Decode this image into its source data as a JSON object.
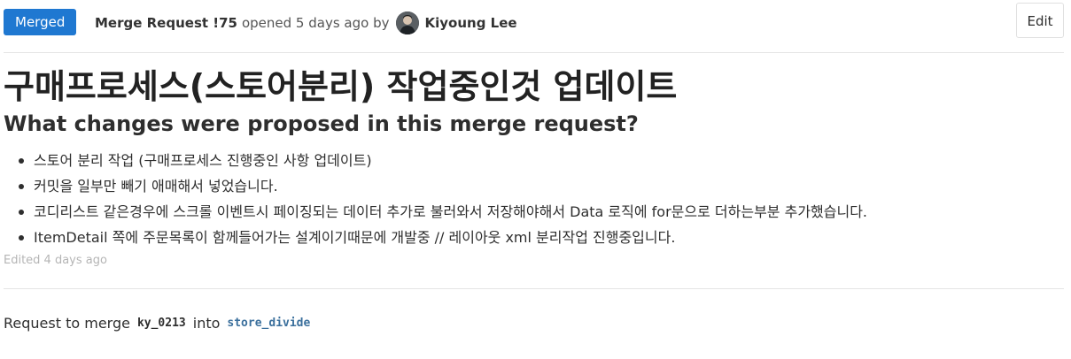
{
  "header": {
    "status_label": "Merged",
    "mr_ref": "Merge Request !75",
    "opened_text": "opened 5 days ago by",
    "author_name": "Kiyoung Lee",
    "edit_label": "Edit"
  },
  "title": "구매프로세스(스토어분리) 작업중인것 업데이트",
  "description": {
    "heading": "What changes were proposed in this merge request?",
    "items": [
      "스토어 분리 작업 (구매프로세스 진행중인 사항 업데이트)",
      "커밋을 일부만 빼기 애매해서 넣었습니다.",
      "코디리스트 같은경우에 스크롤 이벤트시 페이징되는 데이터 추가로 불러와서 저장해야해서 Data 로직에 for문으로 더하는부분 추가했습니다.",
      "ItemDetail 쪽에 주문목록이 함께들어가는 설계이기때문에 개발중 // 레이아웃 xml 분리작업 진행중입니다."
    ],
    "edited_note": "Edited 4 days ago"
  },
  "merge_info": {
    "prefix": "Request to merge",
    "source_branch": "ky_0213",
    "into": "into",
    "target_branch": "store_divide"
  },
  "colors": {
    "merged_badge": "#1f78d1",
    "target_branch": "#3a6f9c"
  }
}
